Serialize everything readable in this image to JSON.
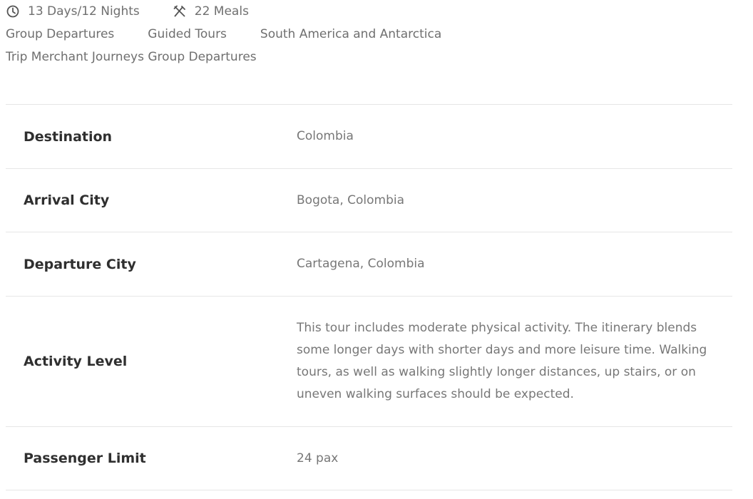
{
  "meta": {
    "duration": "13 Days/12 Nights",
    "meals": "22 Meals",
    "icons": {
      "duration": "clock-icon",
      "meals": "utensils-icon"
    }
  },
  "tags": [
    "Group Departures",
    "Guided Tours",
    "South America and Antarctica"
  ],
  "journeys_line": "Trip Merchant Journeys Group Departures",
  "details": [
    {
      "label": "Destination",
      "value": "Colombia"
    },
    {
      "label": "Arrival City",
      "value": "Bogota, Colombia"
    },
    {
      "label": "Departure City",
      "value": "Cartagena, Colombia"
    },
    {
      "label": "Activity Level",
      "value": "This tour includes moderate physical activity. The itinerary blends some longer days with shorter days and more leisure time. Walking tours, as well as walking slightly longer distances, up stairs, or on uneven walking surfaces should be expected."
    },
    {
      "label": "Passenger Limit",
      "value": "24 pax"
    }
  ]
}
